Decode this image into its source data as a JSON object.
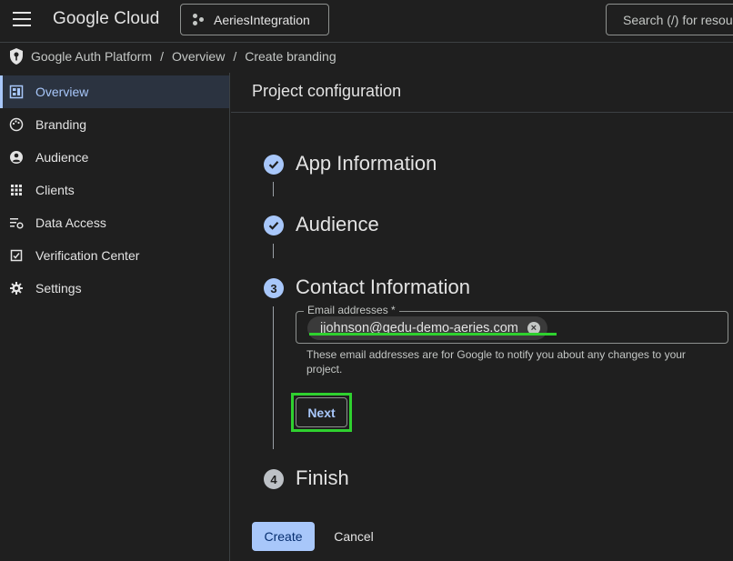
{
  "header": {
    "logo": "Google Cloud",
    "project": "AeriesIntegration",
    "search_placeholder": "Search (/) for resources"
  },
  "breadcrumb": [
    "Google Auth Platform",
    "Overview",
    "Create branding"
  ],
  "sidebar": {
    "items": [
      {
        "label": "Overview",
        "icon": "dashboard-icon",
        "active": true
      },
      {
        "label": "Branding",
        "icon": "palette-icon",
        "active": false
      },
      {
        "label": "Audience",
        "icon": "account-circle-icon",
        "active": false
      },
      {
        "label": "Clients",
        "icon": "grid-icon",
        "active": false
      },
      {
        "label": "Data Access",
        "icon": "data-access-icon",
        "active": false
      },
      {
        "label": "Verification Center",
        "icon": "check-box-icon",
        "active": false
      },
      {
        "label": "Settings",
        "icon": "gear-icon",
        "active": false
      }
    ]
  },
  "main": {
    "title": "Project configuration",
    "steps": [
      {
        "number": "1",
        "title": "App Information",
        "state": "done"
      },
      {
        "number": "2",
        "title": "Audience",
        "state": "done"
      },
      {
        "number": "3",
        "title": "Contact Information",
        "state": "current"
      },
      {
        "number": "4",
        "title": "Finish",
        "state": "pending"
      }
    ],
    "email_field": {
      "label": "Email addresses *",
      "chip": "jjohnson@gedu-demo-aeries.com",
      "hint": "These email addresses are for Google to notify you about any changes to your project."
    },
    "next_label": "Next",
    "create_label": "Create",
    "cancel_label": "Cancel"
  },
  "colors": {
    "accent": "#a8c7fa",
    "highlight": "#2fd12f",
    "background": "#1f1f1f"
  }
}
